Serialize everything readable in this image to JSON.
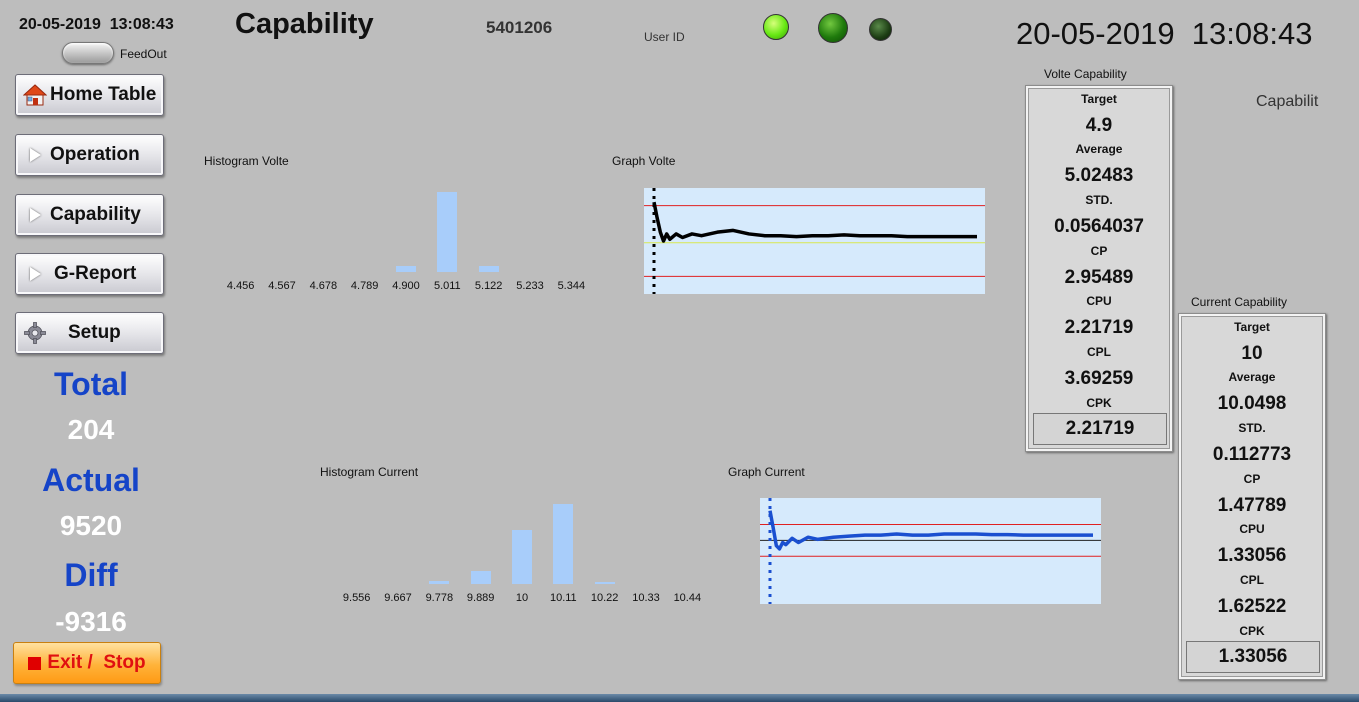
{
  "header": {
    "small_datetime": "20-05-2019  13:08:43",
    "toggle_label": "FeedOut",
    "page_title": "Capability",
    "serial": "5401206",
    "user_id_label": "User ID",
    "big_datetime": "20-05-2019  13:08:43"
  },
  "nav": {
    "home": "Home Table",
    "operation": "Operation",
    "capability": "Capability",
    "greport": "G-Report",
    "setup": "Setup"
  },
  "stats": {
    "total_label": "Total",
    "total_value": "204",
    "actual_label": "Actual",
    "actual_value": "9520",
    "diff_label": "Diff",
    "diff_value": "-9316"
  },
  "exit_label": "Exit /  Stop",
  "captions": {
    "hist_volte": "Histogram Volte",
    "graph_volte": "Graph Volte",
    "hist_current": "Histogram Current",
    "graph_current": "Graph Current",
    "side_label": "Capabilit"
  },
  "volte_capability": {
    "title": "Volte Capability",
    "target_label": "Target",
    "target": "4.9",
    "average_label": "Average",
    "average": "5.02483",
    "std_label": "STD.",
    "std": "0.0564037",
    "cp_label": "CP",
    "cp": "2.95489",
    "cpu_label": "CPU",
    "cpu": "2.21719",
    "cpl_label": "CPL",
    "cpl": "3.69259",
    "cpk_label": "CPK",
    "cpk": "2.21719"
  },
  "current_capability": {
    "title": "Current Capability",
    "target_label": "Target",
    "target": "10",
    "average_label": "Average",
    "average": "10.0498",
    "std_label": "STD.",
    "std": "0.112773",
    "cp_label": "CP",
    "cp": "1.47789",
    "cpu_label": "CPU",
    "cpu": "1.33056",
    "cpl_label": "CPL",
    "cpl": "1.62522",
    "cpk_label": "CPK",
    "cpk": "1.33056"
  },
  "colors": {
    "stat_label": "#1544c8",
    "hist_bar": "#a8cdfa",
    "graph_bg": "#d6eafc",
    "limit_line": "#e02020",
    "target_line_volte": "#d8e850",
    "volte_series": "#000000",
    "current_series": "#1a4fd0"
  },
  "chart_data": [
    {
      "type": "bar",
      "id": "hist-volte",
      "categories": [
        "4.456",
        "4.567",
        "4.678",
        "4.789",
        "4.900",
        "5.011",
        "5.122",
        "5.233",
        "5.344"
      ],
      "values": [
        0,
        0,
        0,
        0,
        8,
        100,
        7,
        0,
        0
      ]
    },
    {
      "type": "line",
      "id": "graph-volte",
      "ylim": [
        4.7,
        5.3
      ],
      "upper_limit": 5.2,
      "lower_limit": 4.8,
      "target": 4.99,
      "x": [
        0,
        2,
        4,
        6,
        8,
        10,
        14,
        18,
        24,
        30,
        40,
        50,
        60,
        70,
        80,
        90,
        100,
        110,
        120,
        130,
        140,
        150,
        160,
        170,
        180,
        190,
        204
      ],
      "y": [
        5.22,
        5.13,
        5.05,
        5.0,
        5.04,
        5.01,
        5.04,
        5.02,
        5.04,
        5.03,
        5.05,
        5.06,
        5.04,
        5.03,
        5.03,
        5.025,
        5.03,
        5.03,
        5.035,
        5.03,
        5.03,
        5.03,
        5.025,
        5.025,
        5.025,
        5.025,
        5.025
      ]
    },
    {
      "type": "bar",
      "id": "hist-current",
      "categories": [
        "9.556",
        "9.667",
        "9.778",
        "9.889",
        "10",
        "10.11",
        "10.22",
        "10.33",
        "10.44"
      ],
      "values": [
        0,
        0,
        4,
        16,
        68,
        100,
        3,
        0,
        0
      ]
    },
    {
      "type": "line",
      "id": "graph-current",
      "ylim": [
        9.4,
        10.4
      ],
      "upper_limit": 10.15,
      "lower_limit": 9.85,
      "target": 10.0,
      "x": [
        0,
        2,
        4,
        6,
        8,
        10,
        14,
        18,
        24,
        30,
        40,
        50,
        60,
        70,
        80,
        90,
        100,
        110,
        120,
        130,
        140,
        150,
        160,
        170,
        180,
        190,
        204
      ],
      "y": [
        10.28,
        10.12,
        9.95,
        9.92,
        9.98,
        9.96,
        10.02,
        9.98,
        10.03,
        10.01,
        10.03,
        10.04,
        10.05,
        10.05,
        10.06,
        10.05,
        10.05,
        10.06,
        10.06,
        10.06,
        10.055,
        10.055,
        10.05,
        10.05,
        10.05,
        10.05,
        10.05
      ]
    }
  ]
}
